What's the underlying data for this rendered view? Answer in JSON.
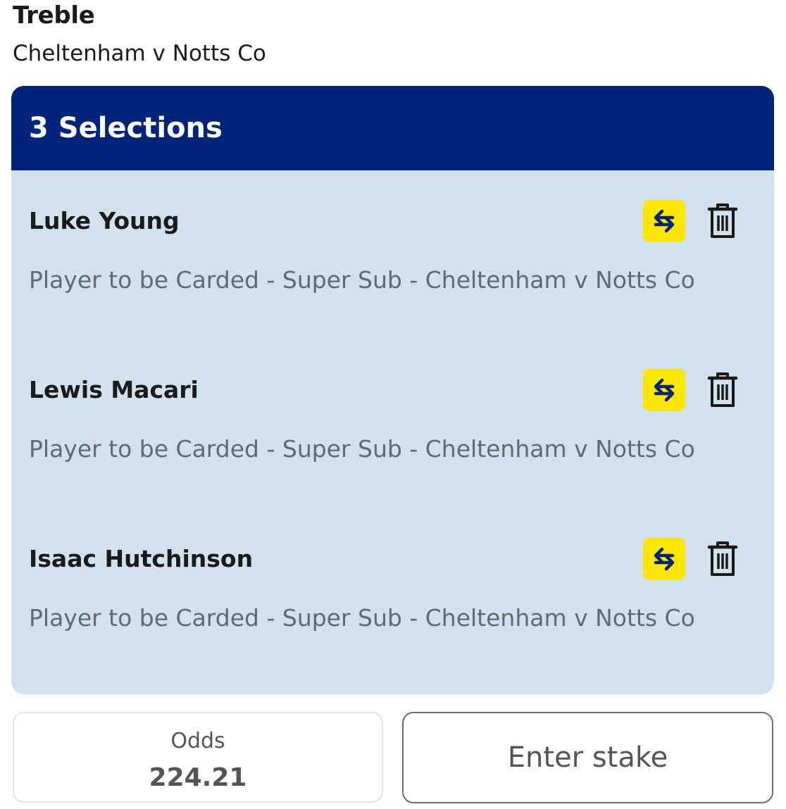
{
  "bet": {
    "type": "Treble",
    "event": "Cheltenham v Notts Co"
  },
  "card": {
    "header": "3 Selections",
    "selections": [
      {
        "name": "Luke Young",
        "market": "Player to be Carded - Super Sub - Cheltenham v Notts Co"
      },
      {
        "name": "Lewis Macari",
        "market": "Player to be Carded - Super Sub - Cheltenham v Notts Co"
      },
      {
        "name": "Isaac Hutchinson",
        "market": "Player to be Carded - Super Sub - Cheltenham v Notts Co"
      }
    ],
    "icons": {
      "swap": "swap-arrows-icon",
      "delete": "trash-icon"
    }
  },
  "footer": {
    "odds_label": "Odds",
    "odds_value": "224.21",
    "stake_placeholder": "Enter stake"
  },
  "colors": {
    "header_bg": "#00247a",
    "card_bg": "#d1e1ee",
    "swap_bg": "#ffe600",
    "swap_icon": "#00247a"
  }
}
